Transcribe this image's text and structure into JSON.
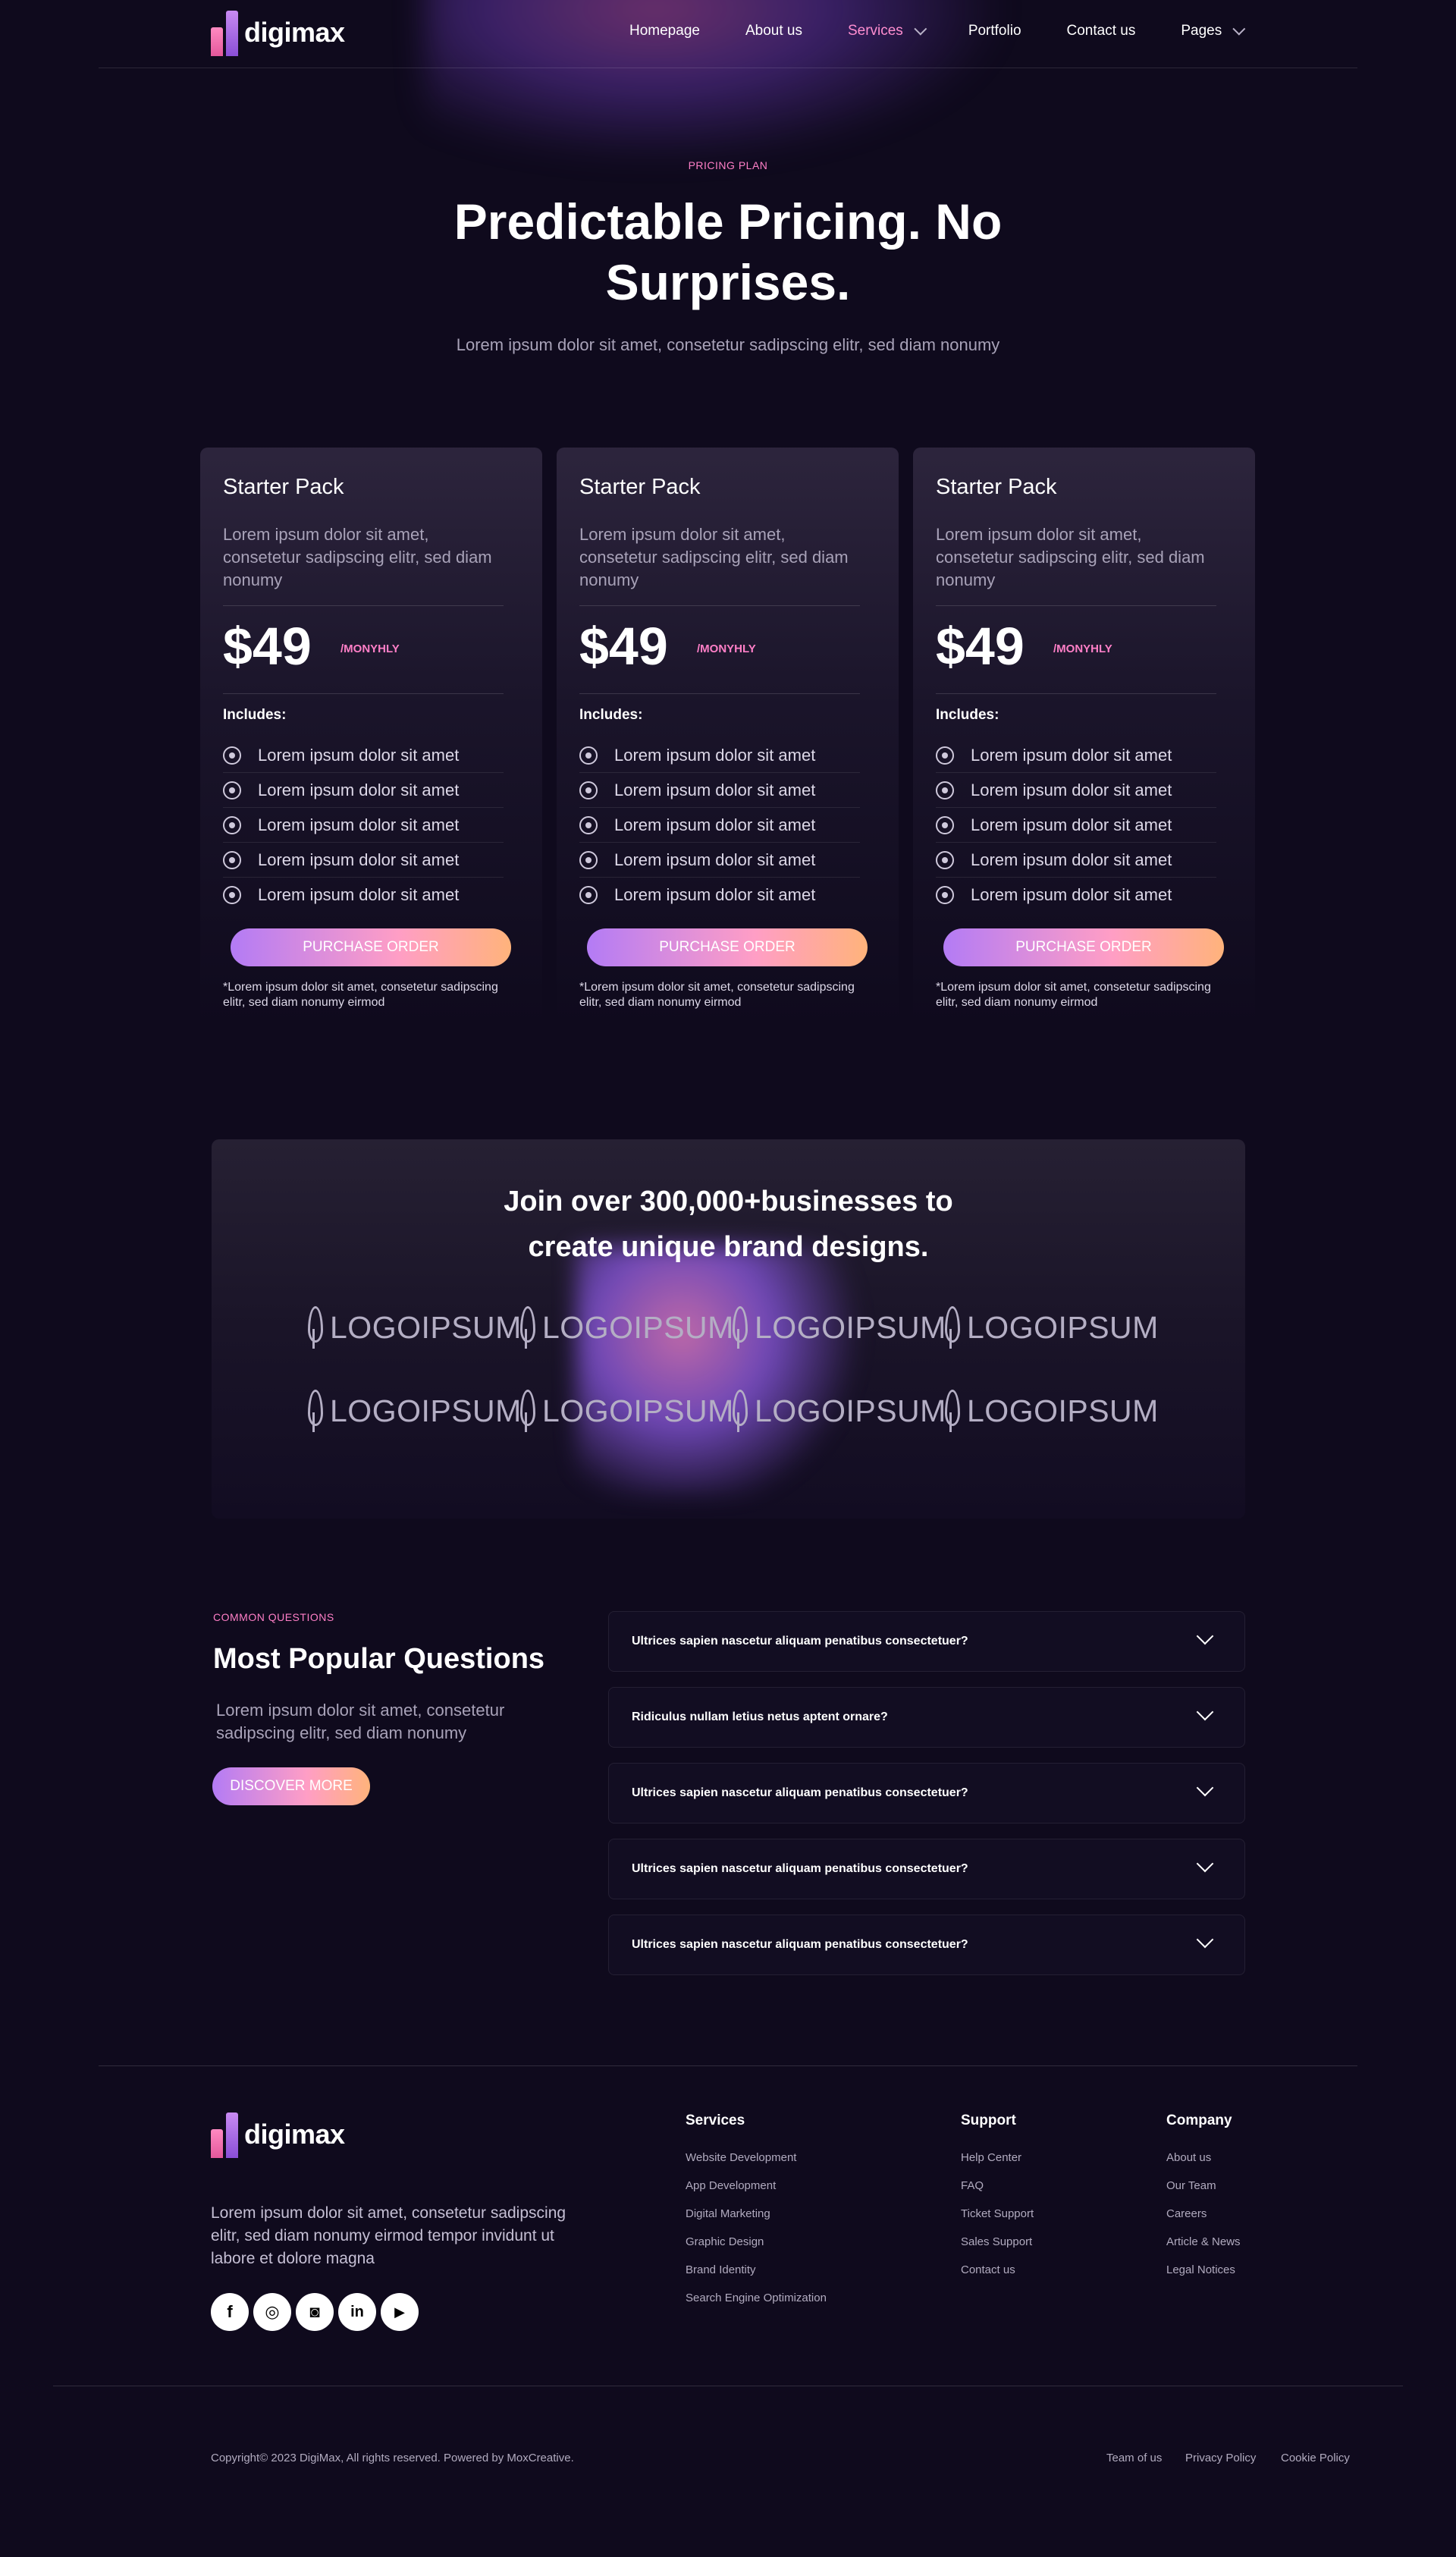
{
  "brand": {
    "name": "digimax"
  },
  "nav": {
    "items": [
      {
        "label": "Homepage"
      },
      {
        "label": "About us"
      },
      {
        "label": "Services"
      },
      {
        "label": "Portfolio"
      },
      {
        "label": "Contact us"
      },
      {
        "label": "Pages"
      }
    ],
    "active": "Services"
  },
  "hero": {
    "eyebrow": "PRICING PLAN",
    "title_line1": "Predictable Pricing. No",
    "title_line2": "Surprises.",
    "subtitle": "Lorem ipsum dolor sit amet, consetetur sadipscing elitr, sed diam nonumy"
  },
  "pricing": {
    "cards": [
      {
        "title": "Starter Pack",
        "description": "Lorem ipsum dolor sit amet, consetetur sadipscing elitr, sed diam nonumy",
        "price": "$49",
        "period": "/MONYHLY",
        "includes_label": "Includes:",
        "features": [
          "Lorem ipsum dolor sit amet",
          "Lorem ipsum dolor sit amet",
          "Lorem ipsum dolor sit amet",
          "Lorem ipsum dolor sit amet",
          "Lorem ipsum dolor sit amet"
        ],
        "button": "PURCHASE ORDER",
        "note": "*Lorem ipsum dolor sit amet, consetetur sadipscing elitr, sed diam nonumy eirmod"
      },
      {
        "title": "Starter Pack",
        "description": "Lorem ipsum dolor sit amet, consetetur sadipscing elitr, sed diam nonumy",
        "price": "$49",
        "period": "/MONYHLY",
        "includes_label": "Includes:",
        "features": [
          "Lorem ipsum dolor sit amet",
          "Lorem ipsum dolor sit amet",
          "Lorem ipsum dolor sit amet",
          "Lorem ipsum dolor sit amet",
          "Lorem ipsum dolor sit amet"
        ],
        "button": "PURCHASE ORDER",
        "note": "*Lorem ipsum dolor sit amet, consetetur sadipscing elitr, sed diam nonumy eirmod"
      },
      {
        "title": "Starter Pack",
        "description": "Lorem ipsum dolor sit amet, consetetur sadipscing elitr, sed diam nonumy",
        "price": "$49",
        "period": "/MONYHLY",
        "includes_label": "Includes:",
        "features": [
          "Lorem ipsum dolor sit amet",
          "Lorem ipsum dolor sit amet",
          "Lorem ipsum dolor sit amet",
          "Lorem ipsum dolor sit amet",
          "Lorem ipsum dolor sit amet"
        ],
        "button": "PURCHASE ORDER",
        "note": "*Lorem ipsum dolor sit amet, consetetur sadipscing elitr, sed diam nonumy eirmod"
      }
    ]
  },
  "brands": {
    "title_line1": "Join over 300,000+businesses to",
    "title_line2": "create unique brand designs.",
    "logos": [
      "LOGOIPSUM",
      "LOGOIPSUM",
      "LOGOIPSUM",
      "LOGOIPSUM",
      "LOGOIPSUM",
      "LOGOIPSUM",
      "LOGOIPSUM",
      "LOGOIPSUM"
    ]
  },
  "faq": {
    "eyebrow": "COMMON QUESTIONS",
    "title": "Most Popular Questions",
    "description": "Lorem ipsum dolor sit amet, consetetur sadipscing elitr, sed diam nonumy",
    "button": "DISCOVER MORE",
    "questions": [
      "Ultrices sapien nascetur aliquam penatibus consectetuer?",
      "Ridiculus nullam letius netus aptent ornare?",
      "Ultrices sapien nascetur aliquam penatibus consectetuer?",
      "Ultrices sapien nascetur aliquam penatibus consectetuer?",
      "Ultrices sapien nascetur aliquam penatibus consectetuer?"
    ]
  },
  "footer": {
    "brand": "digimax",
    "description": "Lorem ipsum dolor sit amet, consetetur sadipscing elitr, sed diam nonumy eirmod tempor invidunt ut labore et dolore magna",
    "social": [
      "facebook-icon",
      "dribbble-icon",
      "instagram-icon",
      "linkedin-icon",
      "youtube-icon"
    ],
    "columns": [
      {
        "heading": "Services",
        "links": [
          "Website Development",
          "App Development",
          "Digital Marketing",
          "Graphic Design",
          "Brand Identity",
          "Search Engine Optimization"
        ]
      },
      {
        "heading": "Support",
        "links": [
          "Help Center",
          "FAQ",
          "Ticket Support",
          "Sales Support",
          "Contact us"
        ]
      },
      {
        "heading": "Company",
        "links": [
          "About us",
          "Our Team",
          "Careers",
          "Article & News",
          "Legal Notices"
        ]
      }
    ],
    "copyright": "Copyright© 2023 DigiMax, All rights reserved. Powered by MoxCreative.",
    "bottom_links": [
      "Team of us",
      "Privacy Policy",
      "Cookie Policy"
    ]
  },
  "colors": {
    "background": "#0f0a1d",
    "accent_pink": "#ff7fc7",
    "gradient_start": "#b37bf5",
    "gradient_end": "#ffb37b"
  }
}
